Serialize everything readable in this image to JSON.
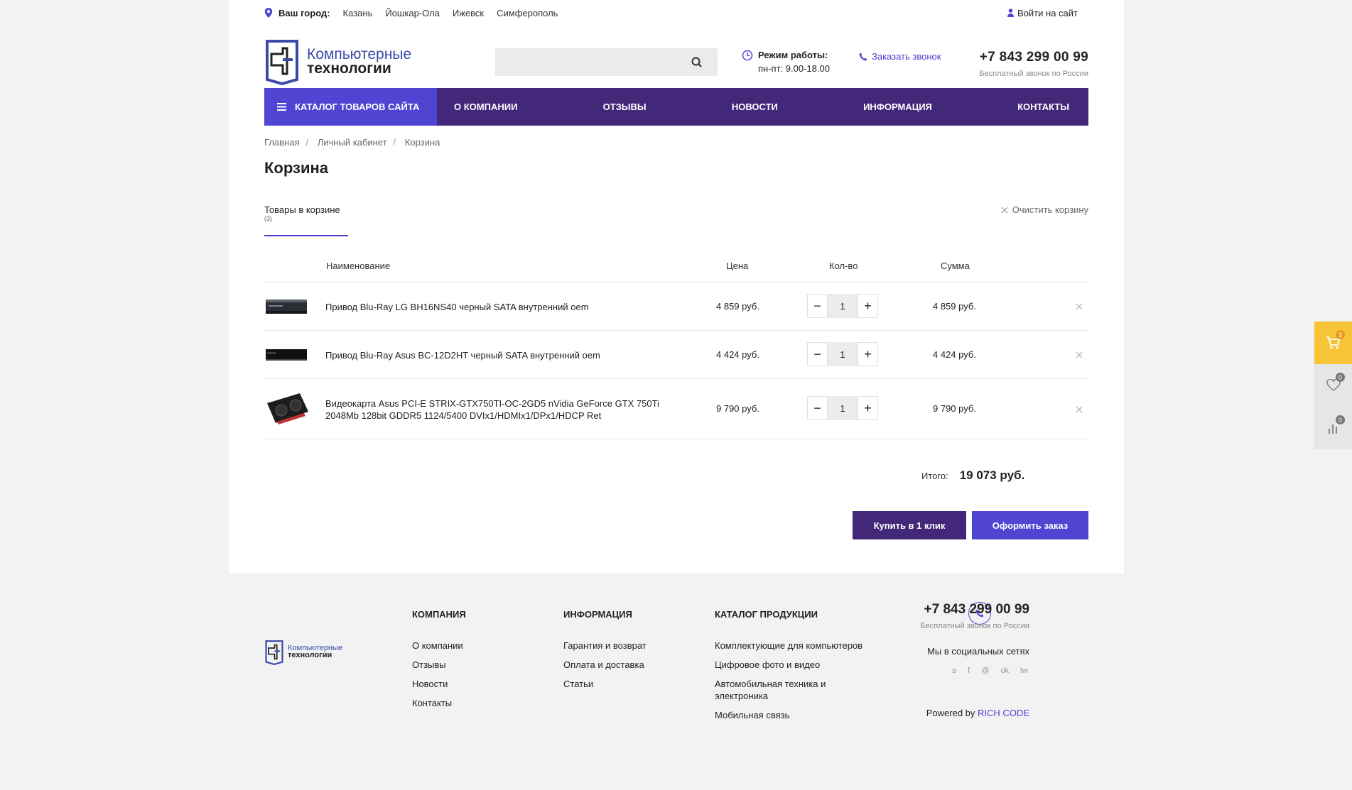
{
  "topbar": {
    "city_label": "Ваш город:",
    "cities": [
      "Казань",
      "Йошкар-Ола",
      "Ижевск",
      "Симферополь"
    ],
    "login": "Войти на сайт"
  },
  "header": {
    "logo_line1": "Компьютерные",
    "logo_line2": "технологии",
    "search_placeholder": "",
    "hours_title": "Режим работы:",
    "hours_value": "пн-пт: 9.00-18.00",
    "callback": "Заказать звонок",
    "phone": "+7 843 299 00 99",
    "phone_note": "Бесплатный звонок по России"
  },
  "nav": {
    "catalog": "Каталог товаров сайта",
    "items": [
      "О компании",
      "Отзывы",
      "Новости",
      "Информация",
      "Контакты"
    ]
  },
  "breadcrumb": [
    "Главная",
    "Личный кабинет",
    "Корзина"
  ],
  "page_title": "Корзина",
  "tabs": {
    "active_label": "Товары в корзине",
    "active_count": "(3)",
    "clear": "Очистить корзину"
  },
  "table": {
    "headers": {
      "name": "Наименование",
      "price": "Цена",
      "qty": "Кол-во",
      "sum": "Сумма"
    },
    "rows": [
      {
        "name": "Привод Blu-Ray LG BH16NS40 черный SATA внутренний oem",
        "price": "4 859 руб.",
        "qty": "1",
        "sum": "4 859 руб.",
        "thumb": "optical-drive"
      },
      {
        "name": "Привод Blu-Ray Asus BC-12D2HT черный SATA внутренний oem",
        "price": "4 424 руб.",
        "qty": "1",
        "sum": "4 424 руб.",
        "thumb": "optical-drive"
      },
      {
        "name": "Видеокарта Asus PCI-E STRIX-GTX750TI-OC-2GD5 nVidia GeForce GTX 750Ti 2048Mb 128bit GDDR5 1124/5400 DVIx1/HDMIx1/DPx1/HDCP Ret",
        "price": "9 790 руб.",
        "qty": "1",
        "sum": "9 790 руб.",
        "thumb": "graphics-card"
      }
    ]
  },
  "total": {
    "label": "Итого:",
    "amount": "19 073 руб."
  },
  "buttons": {
    "one_click": "Купить в 1 клик",
    "order": "Оформить заказ"
  },
  "footer": {
    "logo_line1": "Компьютерные",
    "logo_line2": "технологии",
    "company": {
      "title": "Компания",
      "links": [
        "О компании",
        "Отзывы",
        "Новости",
        "Контакты"
      ]
    },
    "info": {
      "title": "Информация",
      "links": [
        "Гарантия и возврат",
        "Оплата и доставка",
        "Статьи"
      ]
    },
    "catalog": {
      "title": "Каталог продукции",
      "links": [
        "Комплектующие для компьютеров",
        "Цифровое фото и видео",
        "Автомобильная техника и электроника",
        "Мобильная связь"
      ]
    },
    "phone": "+7 843 299 00 99",
    "phone_note": "Бесплатный звонок по России",
    "social_label": "Мы в социальных сетях",
    "socials": [
      "в",
      "f",
      "@",
      "ok",
      "tw"
    ],
    "powered_prefix": "Powered by",
    "powered_link": "RICH CODE"
  },
  "side_widgets": {
    "cart_count": "3",
    "favorites_count": "0",
    "compare_count": "0"
  },
  "colors": {
    "nav": "#43287a",
    "accent": "#4f45d2",
    "cart_widget": "#f6c437"
  }
}
